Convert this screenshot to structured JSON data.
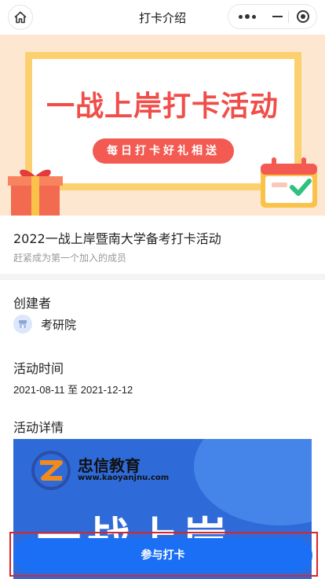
{
  "header": {
    "title": "打卡介绍",
    "home_icon": "home-icon",
    "more_icon": "more-dots-icon",
    "minimize_icon": "minimize-icon",
    "close_icon": "target-close-icon"
  },
  "banner": {
    "headline": "一战上岸打卡活动",
    "pill_text": "每日打卡好礼相送",
    "colors": {
      "background": "#fde7d0",
      "frame": "#fcd06f",
      "headline": "#f04e4a",
      "pill": "#f25a52"
    }
  },
  "activity": {
    "title": "2022一战上岸暨南大学备考打卡活动",
    "subtitle": "赶紧成为第一个加入的成员"
  },
  "creator": {
    "label": "创建者",
    "name": "考研院"
  },
  "time": {
    "label": "活动时间",
    "range": "2021-08-11 至 2021-12-12"
  },
  "details": {
    "label": "活动详情",
    "brand_name": "忠信教育",
    "brand_url": "www.kaoyanjnu.com",
    "slogan": "一战上岸"
  },
  "join": {
    "label": "参与打卡",
    "color": "#1a6ff5",
    "highlight_color": "#d9262b"
  }
}
